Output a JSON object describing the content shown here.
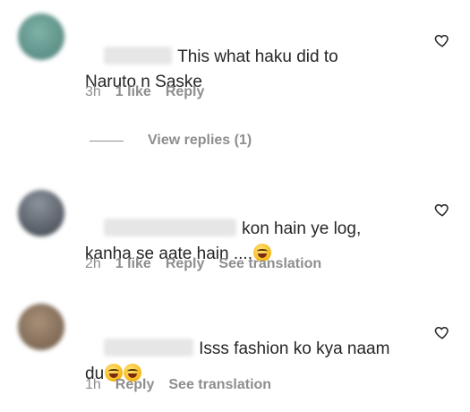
{
  "comments": [
    {
      "text": "This what haku did to\nNaruto n Saske",
      "time": "3h",
      "likes": "1 like",
      "reply": "Reply",
      "translate": "",
      "avatar_color": "#5f8f88"
    },
    {
      "text": "kon hain ye log,\nkanha se aate hain ....",
      "time": "2h",
      "likes": "1 like",
      "reply": "Reply",
      "translate": "See translation",
      "avatar_color": "#5a6068"
    },
    {
      "text": "Isss fashion ko kya naam\ndu",
      "time": "1h",
      "likes": "",
      "reply": "Reply",
      "translate": "See translation",
      "avatar_color": "#8a7460"
    }
  ],
  "view_replies": "View replies (1)",
  "icons": {
    "heart": "heart-outline-icon",
    "emoji": "laughing-emoji-icon"
  },
  "colors": {
    "text": "#262626",
    "secondary": "#8e8e8e"
  }
}
